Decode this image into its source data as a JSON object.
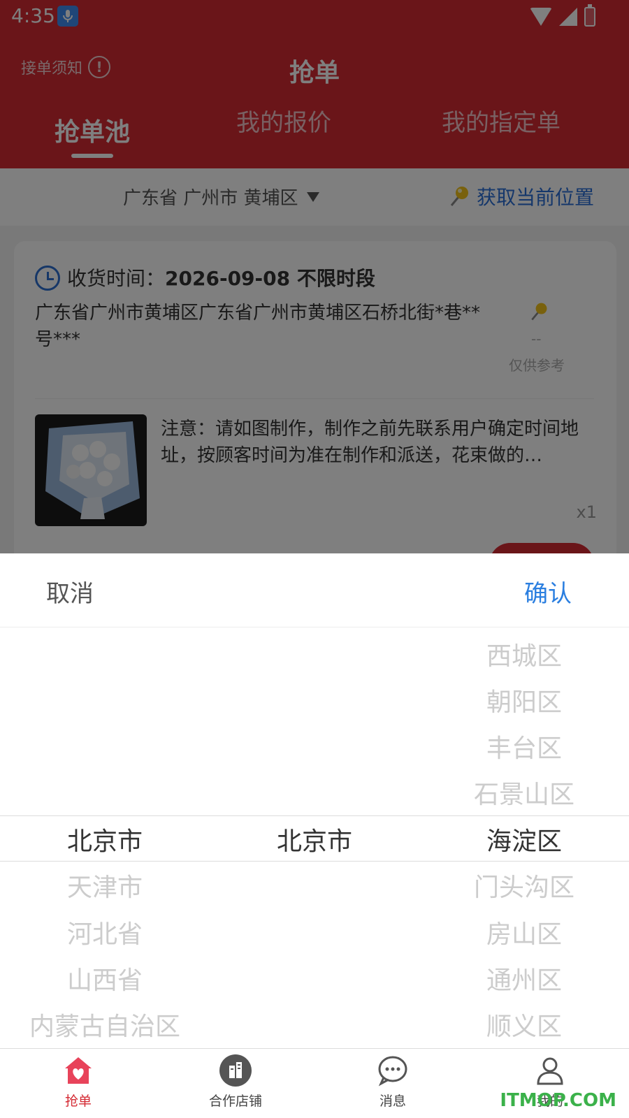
{
  "status_bar": {
    "time": "4:35"
  },
  "header": {
    "notice_label": "接单须知",
    "title": "抢单",
    "tabs": [
      {
        "label": "抢单池",
        "active": true
      },
      {
        "label": "我的报价",
        "active": false
      },
      {
        "label": "我的指定单",
        "active": false
      }
    ]
  },
  "location": {
    "current": "广东省 广州市 黄埔区",
    "get_location_label": "获取当前位置"
  },
  "order": {
    "time_label": "收货时间：",
    "time_value": "2026-09-08 不限时段",
    "address": "广东省广州市黄埔区广东省广州市黄埔区石桥北街*巷**号***",
    "distance": "--",
    "reference": "仅供参考",
    "note": "注意：请如图制作，制作之前先联系用户确定时间地址，按顾客时间为准在制作和派送，花束做的…",
    "quantity": "x1"
  },
  "picker": {
    "cancel_label": "取消",
    "confirm_label": "确认",
    "provinces": [
      "北京市",
      "天津市",
      "河北省",
      "山西省",
      "内蒙古自治区"
    ],
    "cities": [
      "北京市"
    ],
    "districts_above": [
      "西城区",
      "朝阳区",
      "丰台区",
      "石景山区"
    ],
    "district_selected": "海淀区",
    "districts_below": [
      "门头沟区",
      "房山区",
      "通州区",
      "顺义区"
    ]
  },
  "bottom_nav": [
    {
      "label": "抢单",
      "icon": "heart-house-icon",
      "active": true
    },
    {
      "label": "合作店铺",
      "icon": "building-icon",
      "active": false
    },
    {
      "label": "消息",
      "icon": "chat-bubble-icon",
      "active": false
    },
    {
      "label": "我的",
      "icon": "user-icon",
      "active": false
    }
  ],
  "watermark": "ITMOP.COM",
  "colors": {
    "brand": "#d42a33",
    "link": "#2b7fe0"
  }
}
